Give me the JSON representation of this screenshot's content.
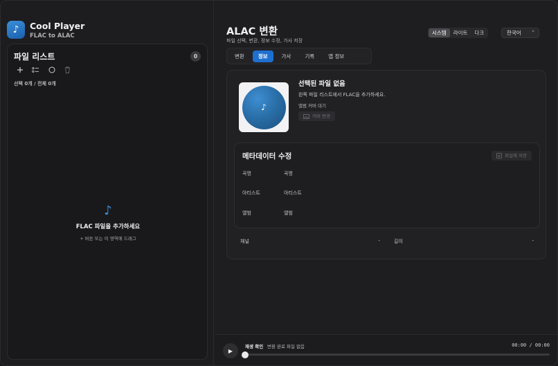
{
  "app": {
    "title": "Cool Player",
    "subtitle": "FLAC to ALAC",
    "icon": "music-note-icon"
  },
  "sidebar": {
    "panel_title": "파일 리스트",
    "file_count": "0",
    "tools": [
      "add-icon",
      "select-list-icon",
      "circle-icon",
      "trash-icon"
    ],
    "selection_info": "선택 0개 / 전체 0개",
    "empty": {
      "icon": "music-note-icon",
      "title": "FLAC 파일을 추가하세요",
      "hint": "+ 버튼 또는 이 영역에 드래그"
    }
  },
  "header": {
    "title": "ALAC 변환",
    "subtitle": "파일 선택, 변환, 정보 수정, 가사 저장",
    "theme_options": [
      "시스템",
      "라이트",
      "다크"
    ],
    "theme_selected": "시스템",
    "language": "한국어"
  },
  "tabs": [
    {
      "label": "변환",
      "active": false
    },
    {
      "label": "정보",
      "active": true
    },
    {
      "label": "가사",
      "active": false
    },
    {
      "label": "기록",
      "active": false
    },
    {
      "label": "앱 정보",
      "active": false
    }
  ],
  "info": {
    "file_title": "선택된 파일 없음",
    "file_desc": "왼쪽 파일 리스트에서 FLAC을 추가하세요.",
    "cover_status": "앨범 커버 대기",
    "cover_change_label": "커버 변경",
    "metadata": {
      "title": "메타데이터 수정",
      "save_label": "파일에 저장",
      "fields": [
        {
          "label": "곡명",
          "value": "곡명"
        },
        {
          "label": "아티스트",
          "value": "아티스트"
        },
        {
          "label": "앨범",
          "value": "앨범"
        }
      ]
    },
    "stats": {
      "channel_label": "채널",
      "channel_value": "-",
      "length_label": "길이",
      "length_value": "-"
    }
  },
  "player": {
    "label": "재생 확인",
    "status": "변환 완료 파일 없음",
    "time": "00:00 / 00:00",
    "progress": 0
  },
  "colors": {
    "accent": "#1f6fd1",
    "background": "#1e1e20"
  }
}
